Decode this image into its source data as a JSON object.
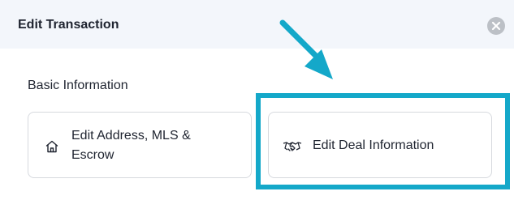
{
  "modal": {
    "title": "Edit Transaction",
    "close_icon": "close-icon"
  },
  "section": {
    "heading": "Basic Information"
  },
  "cards": [
    {
      "label": "Edit Address, MLS & Escrow",
      "icon": "home-icon"
    },
    {
      "label": "Edit Deal Information",
      "icon": "handshake-icon"
    }
  ],
  "annotation": {
    "highlight_color": "#14a8c9",
    "arrow_color": "#14a8c9"
  },
  "colors": {
    "header_bg": "#f3f6fb",
    "text": "#1f2430",
    "card_border": "#d6d9de"
  }
}
